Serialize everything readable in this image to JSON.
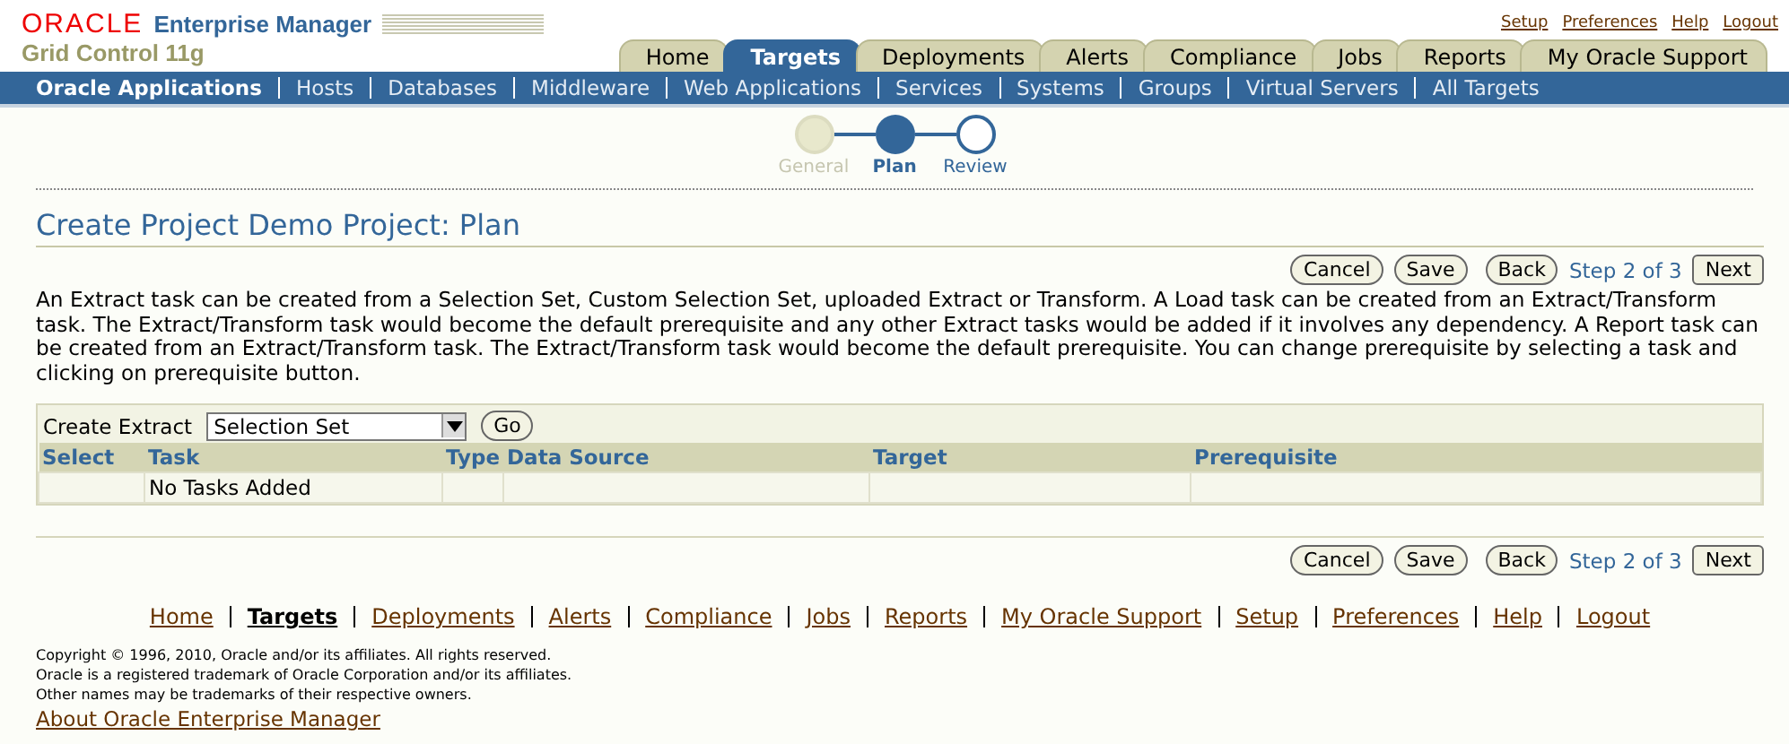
{
  "header": {
    "brand": "ORACLE",
    "product": "Enterprise Manager",
    "subtitle": "Grid Control 11g"
  },
  "global_links": [
    "Setup",
    "Preferences",
    "Help",
    "Logout"
  ],
  "tabs": [
    {
      "label": "Home",
      "selected": false
    },
    {
      "label": "Targets",
      "selected": true
    },
    {
      "label": "Deployments",
      "selected": false
    },
    {
      "label": "Alerts",
      "selected": false
    },
    {
      "label": "Compliance",
      "selected": false
    },
    {
      "label": "Jobs",
      "selected": false
    },
    {
      "label": "Reports",
      "selected": false
    },
    {
      "label": "My Oracle Support",
      "selected": false
    }
  ],
  "subtabs": [
    {
      "label": "Oracle Applications",
      "selected": true
    },
    {
      "label": "Hosts",
      "selected": false
    },
    {
      "label": "Databases",
      "selected": false
    },
    {
      "label": "Middleware",
      "selected": false
    },
    {
      "label": "Web Applications",
      "selected": false
    },
    {
      "label": "Services",
      "selected": false
    },
    {
      "label": "Systems",
      "selected": false
    },
    {
      "label": "Groups",
      "selected": false
    },
    {
      "label": "Virtual Servers",
      "selected": false
    },
    {
      "label": "All Targets",
      "selected": false
    }
  ],
  "train": [
    {
      "label": "General",
      "selected": false,
      "disabled": true
    },
    {
      "label": "Plan",
      "selected": true,
      "disabled": false
    },
    {
      "label": "Review",
      "selected": false,
      "disabled": false
    }
  ],
  "page_title": "Create Project Demo Project: Plan",
  "top_actions": {
    "cancel": "Cancel",
    "save": "Save",
    "back": "Back",
    "step": "Step 2 of 3",
    "next": "Next"
  },
  "description": "An Extract task can be created from a Selection Set, Custom Selection Set, uploaded Extract or Transform. A Load task can be created from an Extract/Transform task. The Extract/Transform task would become the default prerequisite and any other Extract tasks would be added if it involves any dependency. A Report task can be created from an Extract/Transform task. The Extract/Transform task would become the default prerequisite. You can change prerequisite by selecting a task and clicking on prerequisite button.",
  "create_extract": {
    "label": "Create Extract",
    "value": "Selection Set",
    "go": "Go"
  },
  "table": {
    "columns": [
      "Select",
      "Task",
      "Type",
      "Data Source",
      "Target",
      "Prerequisite"
    ],
    "empty_message": "No Tasks Added"
  },
  "bottom_actions": {
    "cancel": "Cancel",
    "save": "Save",
    "back": "Back",
    "step": "Step 2 of 3",
    "next": "Next"
  },
  "footer_links": [
    {
      "label": "Home",
      "selected": false
    },
    {
      "label": "Targets",
      "selected": true
    },
    {
      "label": "Deployments",
      "selected": false
    },
    {
      "label": "Alerts",
      "selected": false
    },
    {
      "label": "Compliance",
      "selected": false
    },
    {
      "label": "Jobs",
      "selected": false
    },
    {
      "label": "Reports",
      "selected": false
    },
    {
      "label": "My Oracle Support",
      "selected": false
    },
    {
      "label": "Setup",
      "selected": false
    },
    {
      "label": "Preferences",
      "selected": false
    },
    {
      "label": "Help",
      "selected": false
    },
    {
      "label": "Logout",
      "selected": false
    }
  ],
  "copyright": [
    "Copyright © 1996, 2010, Oracle and/or its affiliates. All rights reserved.",
    "Oracle is a registered trademark of Oracle Corporation and/or its affiliates.",
    "Other names may be trademarks of their respective owners."
  ],
  "about_link": "About Oracle Enterprise Manager"
}
